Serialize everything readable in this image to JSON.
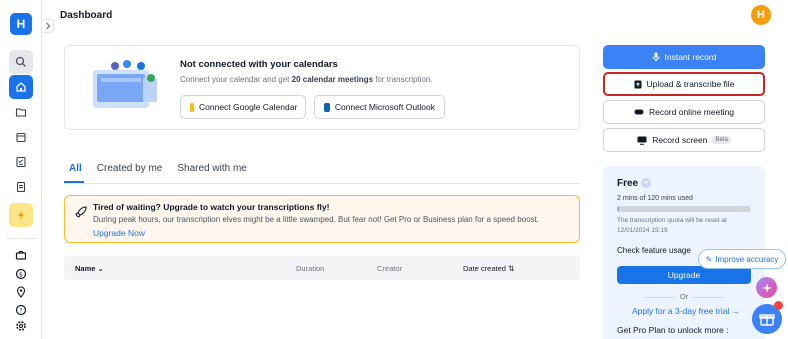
{
  "app": {
    "logo_letter": "H",
    "page_title": "Dashboard",
    "avatar_letter": "H"
  },
  "calendar": {
    "title": "Not connected with your calendars",
    "subtitle_prefix": "Connect your calendar and get ",
    "subtitle_bold": "20 calendar meetings",
    "subtitle_suffix": " for transcription.",
    "google_label": "Connect Google Calendar",
    "outlook_label": "Connect Microsoft Outlook"
  },
  "tabs": [
    "All",
    "Created by me",
    "Shared with me"
  ],
  "banner": {
    "title": "Tired of waiting?  Upgrade to watch your transcriptions fly!",
    "text": "During peak hours, our transcription elves might be a little swamped. But fear not! Get Pro or Business plan for a speed boost.",
    "link": "Upgrade Now"
  },
  "table": {
    "columns": [
      "Name",
      "Duration",
      "Creator",
      "Date created"
    ]
  },
  "actions": {
    "instant_record": "Instant record",
    "upload": "Upload & transcribe file",
    "record_meeting": "Record online meeting",
    "record_screen": "Record screen",
    "beta": "Beta"
  },
  "plan": {
    "title": "Free",
    "usage": "2 mins of 120 mins used",
    "usage_fraction": 0.017,
    "reset": "The transcription quota will be reset at 12/01/2024 15:19",
    "check": "Check feature usage",
    "upgrade": "Upgrade",
    "or": "Or",
    "trial": "Apply for a 3-day free trial →",
    "pro": "Get Pro Plan to unlock more :"
  },
  "improve_accuracy": "Improve accuracy",
  "colors": {
    "accent": "#1a73e8",
    "highlight_border": "#c62828",
    "banner_border": "#fbbf24",
    "avatar": "#f59e0b"
  }
}
